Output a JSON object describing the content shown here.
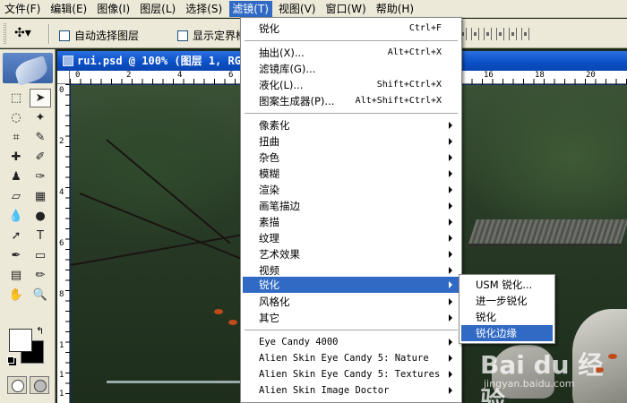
{
  "menubar": {
    "items": [
      "文件(F)",
      "编辑(E)",
      "图像(I)",
      "图层(L)",
      "选择(S)",
      "滤镜(T)",
      "视图(V)",
      "窗口(W)",
      "帮助(H)"
    ],
    "active_index": 5
  },
  "options": {
    "auto_select_layer": "自动选择图层",
    "show_bounds": "显示定界框"
  },
  "document": {
    "title": "rui.psd @ 100% (图层 1, RGB/8)",
    "ruler_top": [
      "0",
      "2",
      "4",
      "6",
      "8",
      "10",
      "12",
      "14",
      "16",
      "18",
      "20"
    ],
    "ruler_left": [
      "0",
      "2",
      "4",
      "6",
      "8",
      "1",
      "1",
      "1"
    ]
  },
  "filter_menu": {
    "last_filter": {
      "label": "锐化",
      "shortcut": "Ctrl+F"
    },
    "group1": [
      {
        "label": "抽出(X)...",
        "shortcut": "Alt+Ctrl+X"
      },
      {
        "label": "滤镜库(G)..."
      },
      {
        "label": "液化(L)...",
        "shortcut": "Shift+Ctrl+X"
      },
      {
        "label": "图案生成器(P)...",
        "shortcut": "Alt+Shift+Ctrl+X"
      }
    ],
    "group2": [
      "像素化",
      "扭曲",
      "杂色",
      "模糊",
      "渲染",
      "画笔描边",
      "素描",
      "纹理",
      "艺术效果",
      "视频",
      "锐化",
      "风格化",
      "其它"
    ],
    "highlighted": "锐化",
    "plugins": [
      "Eye Candy 4000",
      "Alien Skin Eye Candy 5: Nature",
      "Alien Skin Eye Candy 5: Textures",
      "Alien Skin Image Doctor"
    ]
  },
  "sharpen_submenu": {
    "items": [
      "USM 锐化...",
      "进一步锐化",
      "锐化",
      "锐化边缘"
    ],
    "highlighted": "锐化边缘"
  },
  "watermark": {
    "brand": "Bai du 经验",
    "url": "jingyan.baidu.com"
  },
  "colors": {
    "menu_highlight": "#316ac5",
    "chrome": "#ece9d8",
    "title_bar": "#0b4fc6"
  }
}
